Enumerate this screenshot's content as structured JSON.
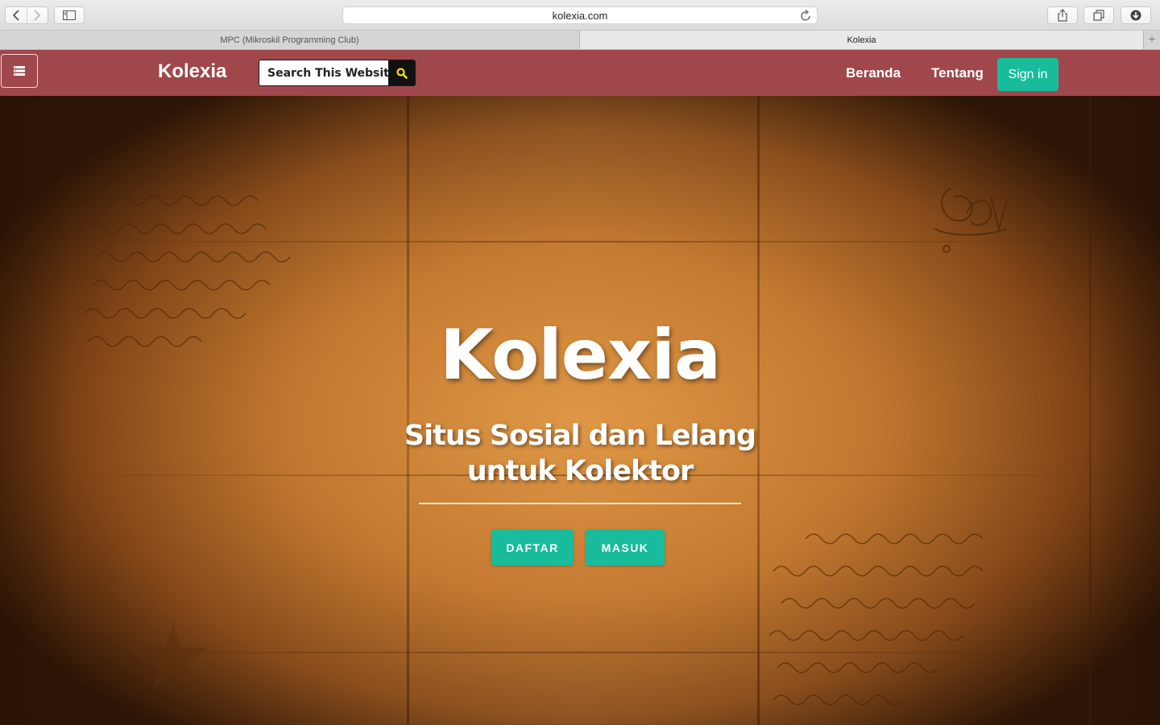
{
  "browser": {
    "url": "kolexia.com",
    "tabs": [
      {
        "label": "MPC (Mikroskil Programming Club)"
      },
      {
        "label": "Kolexia"
      }
    ],
    "new_tab_symbol": "+"
  },
  "nav": {
    "brand": "Kolexia",
    "search": {
      "placeholder": "Search This Website"
    },
    "links": [
      {
        "label": "Beranda"
      },
      {
        "label": "Tentang"
      }
    ],
    "signin_label": "Sign in"
  },
  "hero": {
    "title": "Kolexia",
    "subtitle": "Situs Sosial dan Lelang untuk Kolektor",
    "buttons": [
      {
        "label": "DAFTAR"
      },
      {
        "label": "MASUK"
      }
    ]
  },
  "colors": {
    "nav_bg": "#a0474c",
    "accent": "#18bc9c",
    "search_button_bg": "#111111",
    "search_icon": "#f5e100"
  },
  "icons": {
    "menu_toggle": "list-icon",
    "search": "search-icon",
    "back": "chevron-left-icon",
    "forward": "chevron-right-icon",
    "sidebar": "sidebar-icon",
    "reload": "reload-icon",
    "share": "share-icon",
    "tabs": "tabs-icon",
    "download": "download-icon"
  }
}
